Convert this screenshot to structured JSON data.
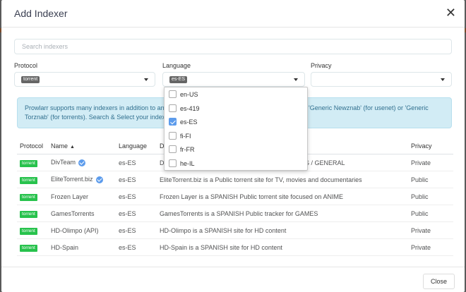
{
  "modal": {
    "title": "Add Indexer",
    "close_icon": "✕"
  },
  "search": {
    "placeholder": "Search indexers",
    "value": ""
  },
  "filters": {
    "protocol": {
      "label": "Protocol",
      "selected": "torrent"
    },
    "language": {
      "label": "Language",
      "selected": "es-ES"
    },
    "privacy": {
      "label": "Privacy",
      "selected": ""
    }
  },
  "alert": {
    "left_line1": "Prowlarr supports many indexers in addition to any i",
    "left_line2": "Torznab' (for torrents). Search & Select your indexer",
    "right_text": "'Generic Newznab' (for usenet) or 'Generic"
  },
  "language_options": [
    {
      "label": "en-US",
      "checked": false
    },
    {
      "label": "es-419",
      "checked": false
    },
    {
      "label": "es-ES",
      "checked": true
    },
    {
      "label": "fi-FI",
      "checked": false
    },
    {
      "label": "fr-FR",
      "checked": false
    },
    {
      "label": "he-IL",
      "checked": false
    }
  ],
  "table": {
    "headers": {
      "protocol": "Protocol",
      "name": "Name",
      "language": "Language",
      "description": "De",
      "privacy": "Privacy"
    },
    "rows": [
      {
        "protocol": "torrent",
        "name": "DivTeam",
        "verified": true,
        "language": "es-ES",
        "description": "Di",
        "description_tail": "ES / GENERAL",
        "privacy": "Private"
      },
      {
        "protocol": "torrent",
        "name": "EliteTorrent.biz",
        "verified": true,
        "language": "es-ES",
        "description": "EliteTorrent.biz is a Public torrent site for TV, movies and documentaries",
        "privacy": "Public"
      },
      {
        "protocol": "torrent",
        "name": "Frozen Layer",
        "verified": false,
        "language": "es-ES",
        "description": "Frozen Layer is a SPANISH Public torrent site focused on ANIME",
        "privacy": "Public"
      },
      {
        "protocol": "torrent",
        "name": "GamesTorrents",
        "verified": false,
        "language": "es-ES",
        "description": "GamesTorrents is a SPANISH Public tracker for GAMES",
        "privacy": "Public"
      },
      {
        "protocol": "torrent",
        "name": "HD-Olimpo (API)",
        "verified": false,
        "language": "es-ES",
        "description": "HD-Olimpo is a SPANISH site for HD content",
        "privacy": "Private"
      },
      {
        "protocol": "torrent",
        "name": "HD-Spain",
        "verified": false,
        "language": "es-ES",
        "description": "HD-Spain is a SPANISH site for HD content",
        "privacy": "Private"
      }
    ]
  },
  "footer": {
    "close_label": "Close"
  },
  "colors": {
    "protocol_badge": "#27c24c",
    "verified_badge": "#5d9cec",
    "alert_bg": "#d2ecf5"
  }
}
